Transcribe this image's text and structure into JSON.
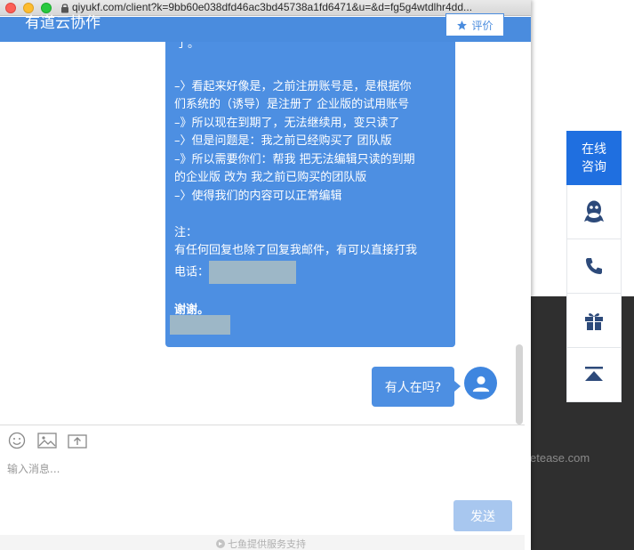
{
  "browser": {
    "url": "qiyukf.com/client?k=9bb60e038dfd46ac3bd45738a1fd6471&u=&d=fg5g4wtdlhr4dd..."
  },
  "header": {
    "title": "有道云协作",
    "rate_label": "评价"
  },
  "conversation": {
    "big_bubble": {
      "top_fragment": "了。",
      "lines": [
        "",
        "–〉看起来好像是，之前注册账号是，是根据你",
        "们系统的（诱导）是注册了 企业版的试用账号",
        "–》所以现在到期了，无法继续用，变只读了",
        "–〉但是问题是：我之前已经购买了 团队版",
        "–》所以需要你们：帮我 把无法编辑只读的到期",
        "的企业版 改为 我之前已购买的团队版",
        "–〉使得我们的内容可以正常编辑",
        "",
        "注：",
        "有任何回复也除了回复我邮件，有可以直接打我"
      ],
      "phone_label": "电话：",
      "thanks": "谢谢。"
    },
    "small_bubble": "有人在吗?"
  },
  "input": {
    "placeholder": "输入消息...",
    "send_label": "发送"
  },
  "footer": {
    "powered_text": "七鱼提供服务支持"
  },
  "side_bar": {
    "consult_line1": "在线",
    "consult_line2": "咨询",
    "icons": [
      "qq-icon",
      "phone-icon",
      "gift-icon",
      "back-to-top-icon"
    ]
  },
  "background": {
    "domain_text": "etease.com"
  },
  "colors": {
    "brand_blue": "#4a8cde",
    "bubble_blue": "#4d8fe2",
    "consult_blue": "#1f6fe0",
    "send_disabled": "#a8c7ef",
    "icon_navy": "#2d4a7a"
  }
}
